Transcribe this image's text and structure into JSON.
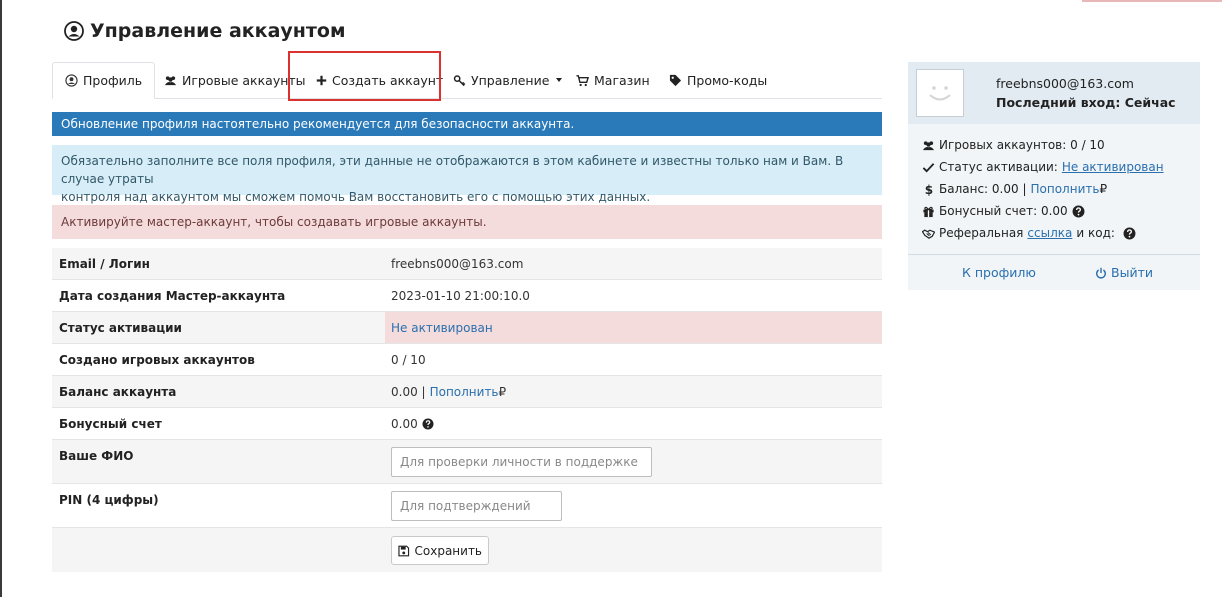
{
  "page": {
    "title": "Управление аккаунтом"
  },
  "tabs": [
    {
      "label": "Профиль",
      "icon": "user-circle-icon",
      "active": true
    },
    {
      "label": "Игровые аккаунты",
      "icon": "users-icon"
    },
    {
      "label": "Создать аккаунт",
      "icon": "plus-icon"
    },
    {
      "label": "Управление",
      "icon": "key-icon",
      "dropdown": true
    },
    {
      "label": "Магазин",
      "icon": "cart-icon"
    },
    {
      "label": "Промо-коды",
      "icon": "tag-icon"
    }
  ],
  "alerts": {
    "primary": "Обновление профиля настоятельно рекомендуется для безопасности аккаунта.",
    "info_line1": "Обязательно заполните все поля профиля, эти данные не отображаются в этом кабинете и известны только нам и Вам. В случае утраты",
    "info_line2": "контроля над аккаунтом мы сможем помочь Вам восстановить его с помощью этих данных.",
    "danger": "Активируйте мастер-аккаунт, чтобы создавать игровые аккаунты."
  },
  "profile": {
    "email_label": "Email / Логин",
    "email_value": "freebns000@163.com",
    "created_label": "Дата создания Мастер-аккаунта",
    "created_value": "2023-01-10 21:00:10.0",
    "status_label": "Статус активации",
    "status_value": "Не активирован",
    "game_accounts_label": "Создано игровых аккаунтов",
    "game_accounts_value": "0 / 10",
    "balance_label": "Баланс аккаунта",
    "balance_value": "0.00 |",
    "balance_topup": "Пополнить",
    "currency": "₽",
    "bonus_label": "Бонусный счет",
    "bonus_value": "0.00",
    "fio_label": "Ваше ФИО",
    "fio_placeholder": "Для проверки личности в поддержке",
    "pin_label": "PIN (4 цифры)",
    "pin_placeholder": "Для подтверждений",
    "save_label": "Сохранить"
  },
  "card": {
    "email": "freebns000@163.com",
    "last_login": "Последний вход: Сейчас",
    "game_accounts": "Игровых аккаунтов: 0 / 10",
    "status_label": "Статус активации:",
    "status_value": "Не активирован",
    "balance_label": "Баланс: 0.00 |",
    "balance_topup": "Пополнить",
    "currency": "₽",
    "bonus": "Бонусный счет: 0.00",
    "referral_label": "Реферальная",
    "referral_link": "ссылка",
    "referral_suffix": "и код:",
    "profile_link": "К профилю",
    "logout": "Выйти"
  },
  "colors": {
    "primary": "#2a7ab9",
    "info_bg": "#d7edf7",
    "danger_bg": "#f4dcdc",
    "link": "#2a6fae",
    "highlight": "#d9322f"
  }
}
